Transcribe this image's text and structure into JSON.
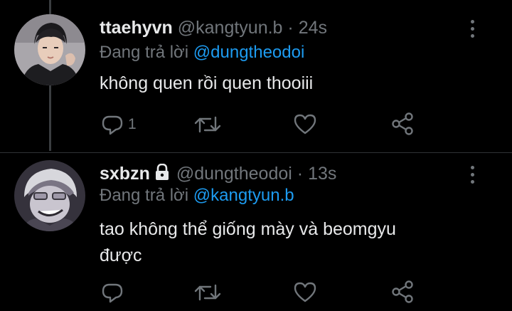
{
  "colors": {
    "background": "#000000",
    "text_primary": "#e8e9ea",
    "text_secondary": "#71767b",
    "accent": "#1d9bf0",
    "divider": "#2f3336"
  },
  "tweets": [
    {
      "display_name": "ttaehyvn",
      "handle": "@kangtyun.b",
      "separator": "·",
      "time": "24s",
      "replying_prefix": "Đang trả lời",
      "replying_to": "@dungtheodoi",
      "text": "không quen rồi quen thooiii",
      "reply_count": "1",
      "locked": false,
      "icons": [
        "reply-icon",
        "retweet-icon",
        "like-icon",
        "share-icon",
        "more-icon"
      ]
    },
    {
      "display_name": "sxbzn",
      "handle": "@dungtheodoi",
      "separator": "·",
      "time": "13s",
      "replying_prefix": "Đang trả lời",
      "replying_to": "@kangtyun.b",
      "text_line1": "tao không thể giống mày và beomgyu",
      "text_line2": "được",
      "reply_count": "",
      "locked": true,
      "icons": [
        "lock-icon",
        "reply-icon",
        "retweet-icon",
        "like-icon",
        "share-icon",
        "more-icon"
      ]
    }
  ]
}
